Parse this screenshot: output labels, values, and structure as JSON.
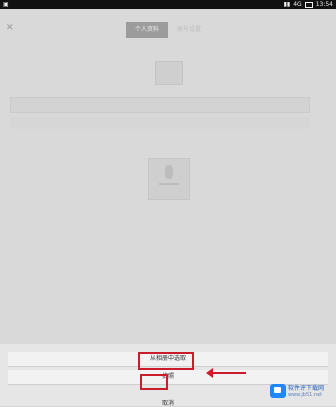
{
  "status_bar": {
    "left": "▣",
    "right_time": "13:54",
    "right_percent": "4G"
  },
  "tabs": [
    {
      "label": "个人资料"
    },
    {
      "label": "账号设置"
    }
  ],
  "sheet": {
    "option_top": "从相册中选取",
    "option_mid": "拍照",
    "cancel": "取消"
  },
  "watermark": {
    "title": "软件评下载网",
    "sub": "www.jb51.net"
  },
  "colors": {
    "highlight": "#cc1b2b",
    "accent": "#1f88ff"
  }
}
